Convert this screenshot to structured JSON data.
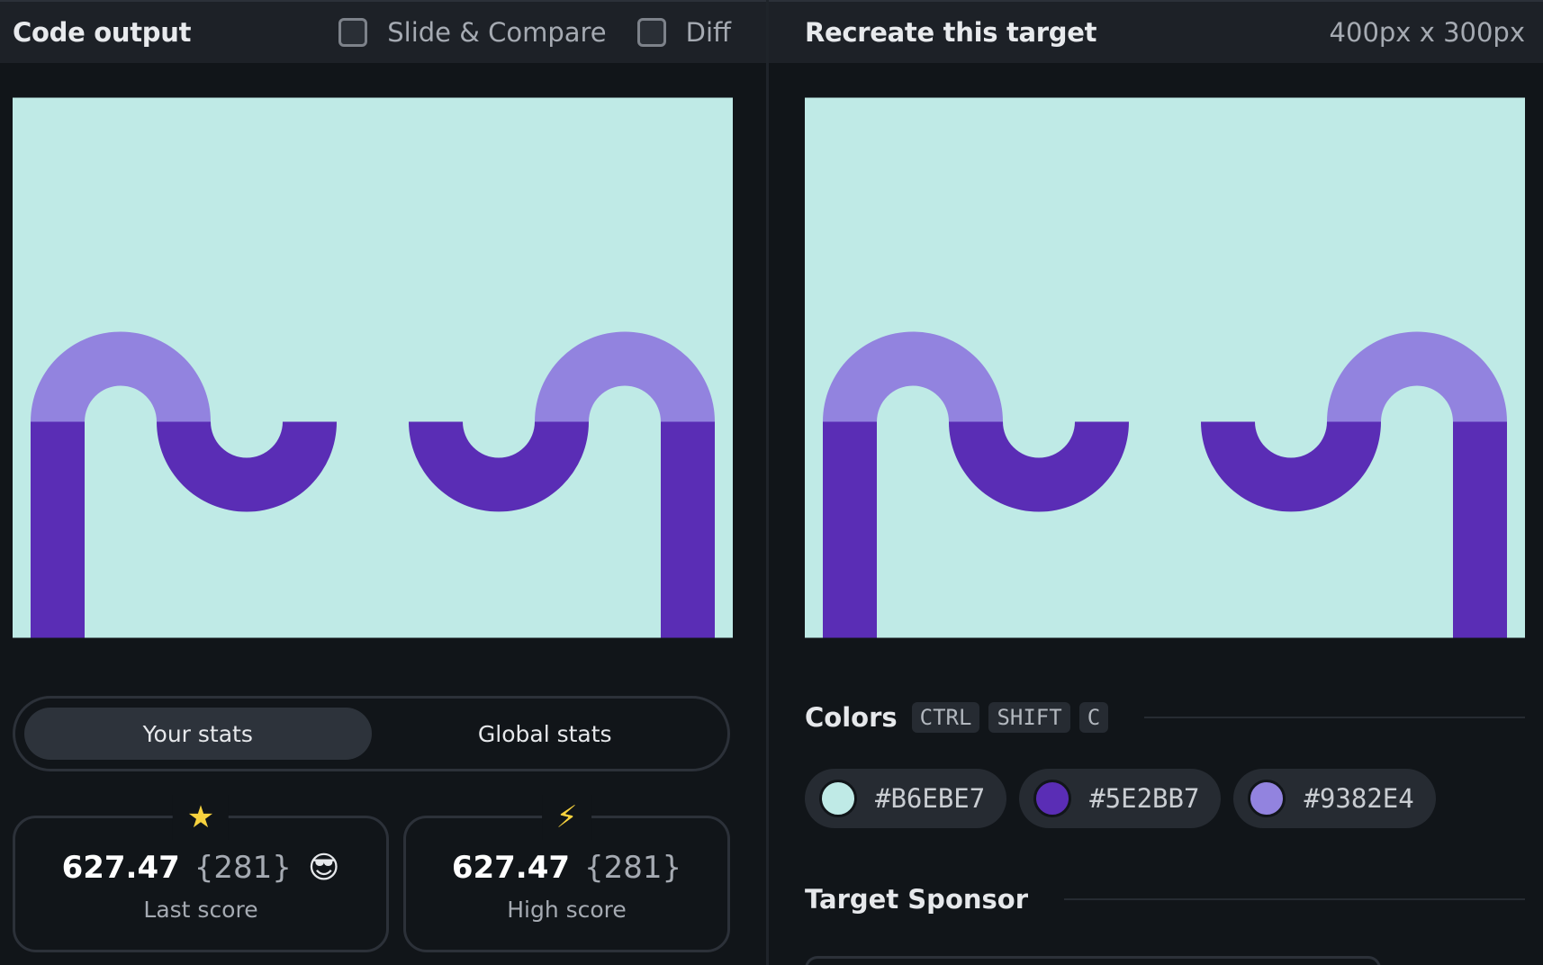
{
  "left_header": {
    "title": "Code output",
    "slide_compare_label": "Slide & Compare",
    "diff_label": "Diff"
  },
  "right_header": {
    "title": "Recreate this target",
    "dimensions": "400px x 300px"
  },
  "stats": {
    "tabs": [
      {
        "label": "Your stats",
        "active": true
      },
      {
        "label": "Global stats",
        "active": false
      }
    ],
    "last": {
      "value": "627.47",
      "count": "{281}",
      "emoji": "😎",
      "caption": "Last score",
      "icon": "star-icon"
    },
    "high": {
      "value": "627.47",
      "count": "{281}",
      "caption": "High score",
      "icon": "lightning-bolt-icon"
    }
  },
  "colors": {
    "title": "Colors",
    "shortcut": [
      "CTRL",
      "SHIFT",
      "C"
    ],
    "swatches": [
      {
        "hex": "#B6EBE7",
        "color": "#BFEAE6"
      },
      {
        "hex": "#5E2BB7",
        "color": "#5A2DB5"
      },
      {
        "hex": "#9382E4",
        "color": "#9283DF"
      }
    ]
  },
  "sponsor": {
    "title": "Target Sponsor"
  },
  "palette": {
    "background": "#BFEAE6",
    "dark_purple": "#5A2DB5",
    "light_purple": "#9283DF"
  }
}
